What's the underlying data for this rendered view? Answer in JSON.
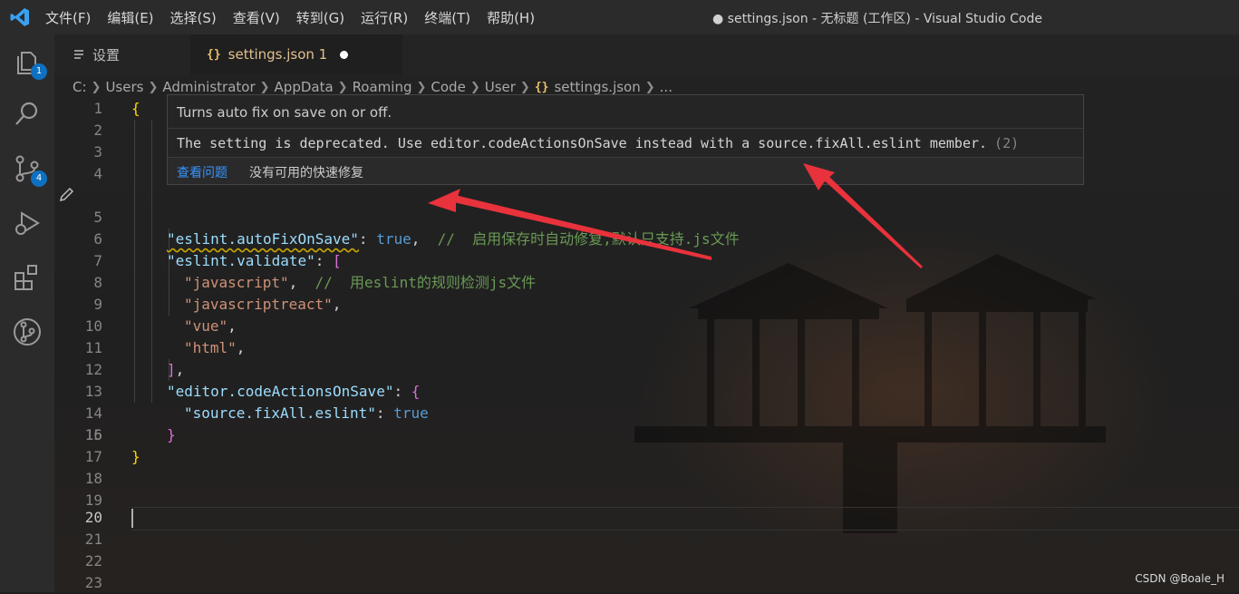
{
  "titlebar": {
    "menu": [
      "文件(F)",
      "编辑(E)",
      "选择(S)",
      "查看(V)",
      "转到(G)",
      "运行(R)",
      "终端(T)",
      "帮助(H)"
    ],
    "window_title": "● settings.json - 无标题 (工作区) - Visual Studio Code"
  },
  "activity": {
    "explorer_badge": "1",
    "scm_badge": "4",
    "icons": [
      "files-icon",
      "search-icon",
      "source-control-icon",
      "run-debug-icon",
      "extensions-icon",
      "git-graph-icon"
    ]
  },
  "tabs": {
    "settings_label": "设置",
    "json_braces": "{}",
    "json_label": "settings.json 1"
  },
  "breadcrumb": {
    "items": [
      "C:",
      "Users",
      "Administrator",
      "AppData",
      "Roaming",
      "Code",
      "User"
    ],
    "braces": "{}",
    "file": "settings.json",
    "more": "..."
  },
  "editor": {
    "line_numbers": [
      "1",
      "2",
      "3",
      "4",
      "5",
      "6",
      "7",
      "8",
      "9",
      "10",
      "11",
      "12",
      "13",
      "14",
      "15",
      "16",
      "17",
      "18",
      "19",
      "20",
      "21",
      "22",
      "23"
    ],
    "active_line": "20",
    "code": {
      "l1_open": "{",
      "l5_key": "\"eslint.autoFixOnSave\"",
      "l5_colon": ": ",
      "l5_val": "true",
      "l5_comma": ",  ",
      "l5_comment": "//  启用保存时自动修复,默认只支持.js文件",
      "l6_key": "\"eslint.validate\"",
      "l6_colon": ": ",
      "l6_open": "[",
      "l7_str": "\"javascript\"",
      "l7_comma": ",  ",
      "l7_comment": "//  用eslint的规则检测js文件",
      "l8_str": "\"javascriptreact\"",
      "l8_comma": ",",
      "l9_str": "\"vue\"",
      "l9_comma": ",",
      "l10_str": "\"html\"",
      "l10_comma": ",",
      "l11_close": "]",
      "l11_comma": ",",
      "l12_key": "\"editor.codeActionsOnSave\"",
      "l12_colon": ": ",
      "l12_open": "{",
      "l13_key": "\"source.fixAll.eslint\"",
      "l13_colon": ": ",
      "l13_val": "true",
      "l14_close": "}",
      "l15_close": "}"
    }
  },
  "hover": {
    "description": "Turns auto fix on save on or off.",
    "message": "The setting is deprecated. Use editor.codeActionsOnSave instead with a source.fixAll.eslint member.",
    "code": "(2)",
    "view_problem": "查看问题",
    "no_quick_fix": "没有可用的快速修复"
  },
  "annotations": {
    "arrow_color": "#e8323c"
  },
  "watermark": "CSDN @Boale_H"
}
